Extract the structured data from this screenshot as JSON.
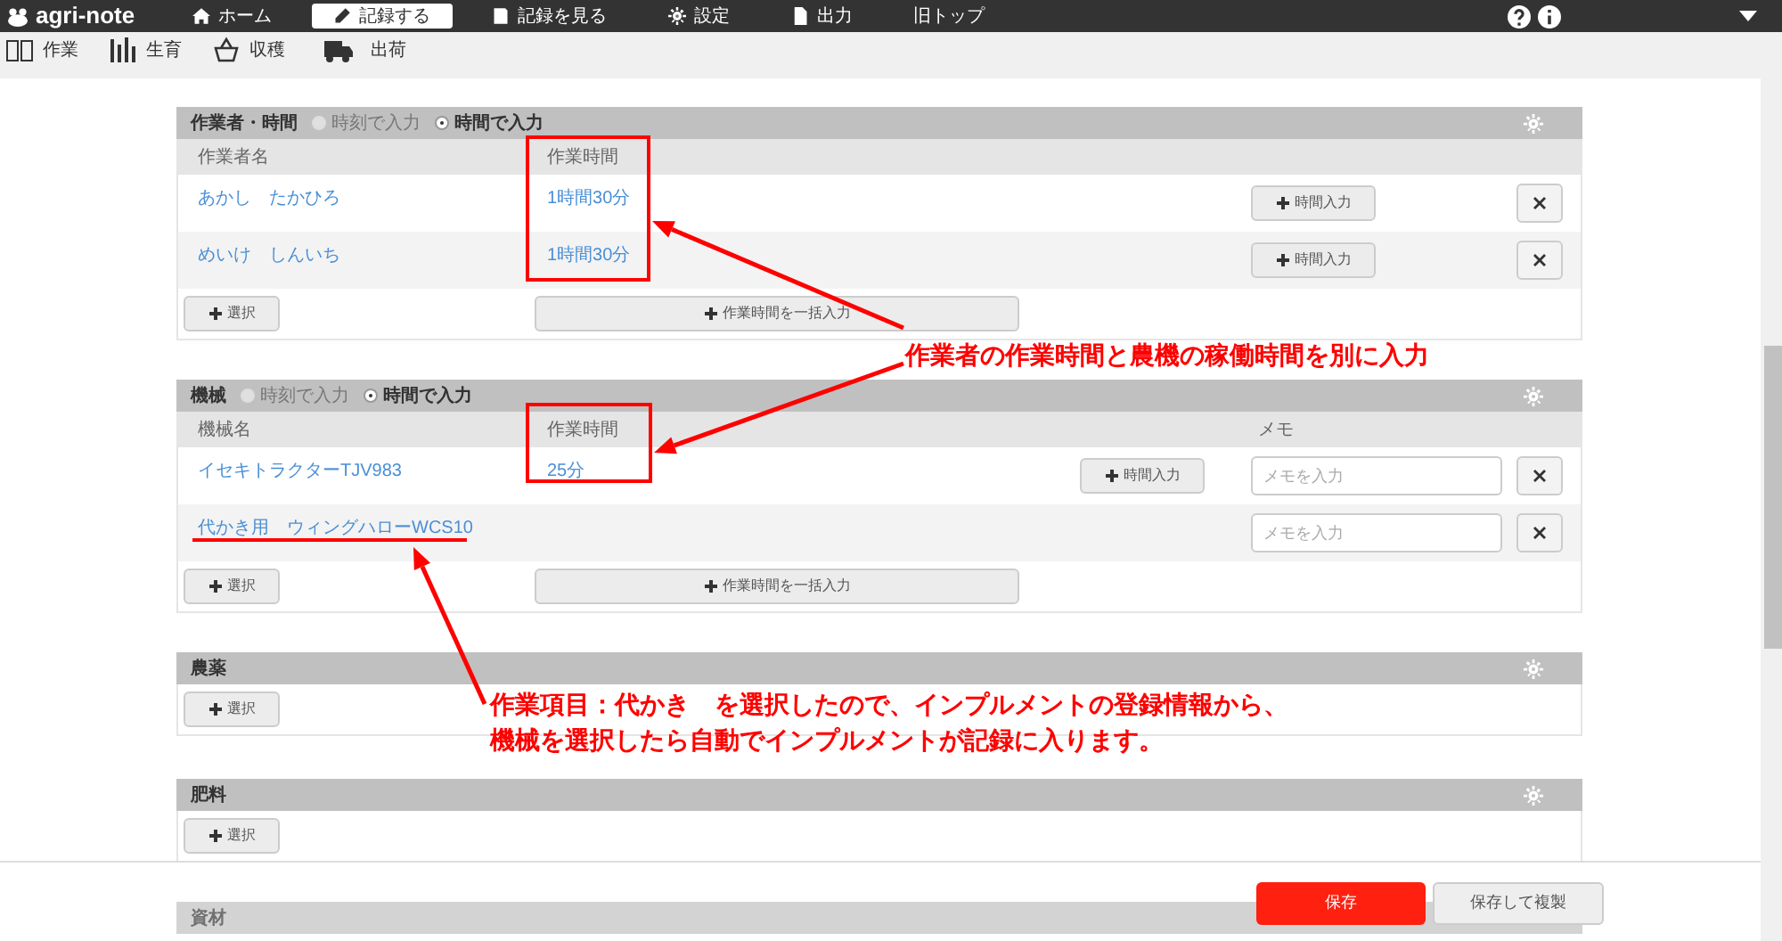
{
  "navbar": {
    "logo": "agri-note",
    "items": [
      {
        "label": "ホーム",
        "selected": false
      },
      {
        "label": "記録する",
        "selected": true
      },
      {
        "label": "記録を見る",
        "selected": false
      },
      {
        "label": "設定",
        "selected": false
      },
      {
        "label": "出力",
        "selected": false
      },
      {
        "label": "旧トップ",
        "selected": false
      }
    ]
  },
  "subnav": {
    "items": [
      {
        "label": "作業"
      },
      {
        "label": "生育"
      },
      {
        "label": "収穫"
      },
      {
        "label": "出荷"
      }
    ]
  },
  "sections": [
    {
      "title": "作業者・時間",
      "modes": [
        {
          "label": "時刻で入力",
          "selected": false
        },
        {
          "label": "時間で入力",
          "selected": true
        }
      ],
      "columns": [
        "作業者名",
        "作業時間"
      ],
      "rows": [
        {
          "name": "あかし　たかひろ",
          "time": "1時間30分",
          "time_button": "時間入力"
        },
        {
          "name": "めいけ　しんいち",
          "time": "1時間30分",
          "time_button": "時間入力"
        }
      ],
      "select_button": "選択",
      "bulk_button": "作業時間を一括入力"
    },
    {
      "title": "機械",
      "modes": [
        {
          "label": "時刻で入力",
          "selected": false
        },
        {
          "label": "時間で入力",
          "selected": true
        }
      ],
      "columns": [
        "機械名",
        "作業時間",
        "メモ"
      ],
      "rows": [
        {
          "name": "イセキトラクターTJV983",
          "time": "25分",
          "time_button": "時間入力",
          "memo_placeholder": "メモを入力"
        },
        {
          "name": "代かき用　ウィングハローWCS10",
          "memo_placeholder": "メモを入力"
        }
      ],
      "select_button": "選択",
      "bulk_button": "作業時間を一括入力"
    },
    {
      "title": "農薬",
      "select_button": "選択"
    },
    {
      "title": "肥料",
      "select_button": "選択"
    },
    {
      "title": "資材"
    }
  ],
  "footer": {
    "save_button": "保存",
    "copy_button": "保存して複製"
  },
  "annotations": {
    "callouts": [
      {
        "lines": [
          "作業者の作業時間と農機の稼働時間を別に入力"
        ]
      },
      {
        "lines": [
          "作業項目：代かき　を選択したので、インプルメントの登録情報から、",
          "機械を選択したら自動でインプルメントが記録に入ります。"
        ]
      }
    ]
  }
}
